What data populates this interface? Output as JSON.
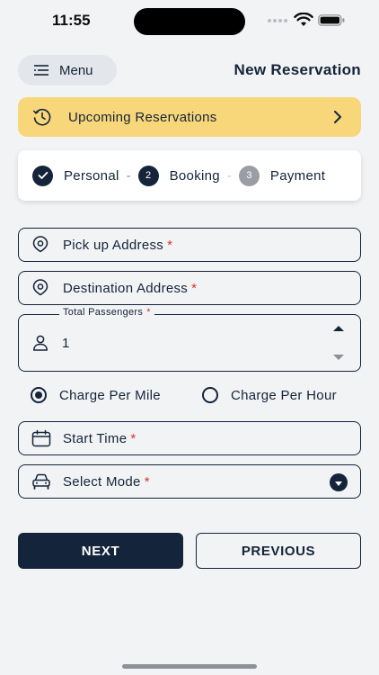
{
  "status_bar": {
    "time": "11:55"
  },
  "header": {
    "menu_label": "Menu",
    "title": "New Reservation"
  },
  "upcoming": {
    "label": "Upcoming Reservations"
  },
  "stepper": {
    "steps": [
      {
        "label": "Personal",
        "number": "",
        "state": "done"
      },
      {
        "label": "Booking",
        "number": "2",
        "state": "active"
      },
      {
        "label": "Payment",
        "number": "3",
        "state": "pending"
      }
    ],
    "separator": "-"
  },
  "form": {
    "pickup": {
      "label": "Pick up Address",
      "required": "*"
    },
    "destination": {
      "label": "Destination Address",
      "required": "*"
    },
    "passengers": {
      "legend": "Total Passengers",
      "required": "*",
      "value": "1"
    },
    "charge": {
      "options": [
        {
          "label": "Charge Per Mile",
          "selected": true
        },
        {
          "label": "Charge Per Hour",
          "selected": false
        }
      ]
    },
    "start_time": {
      "label": "Start Time",
      "required": "*"
    },
    "mode": {
      "label": "Select Mode",
      "required": "*"
    }
  },
  "actions": {
    "next": "NEXT",
    "previous": "PREVIOUS"
  },
  "colors": {
    "primary": "#14243a",
    "accent": "#f8d77a",
    "required": "#d9342b",
    "background": "#f2f3f5"
  }
}
